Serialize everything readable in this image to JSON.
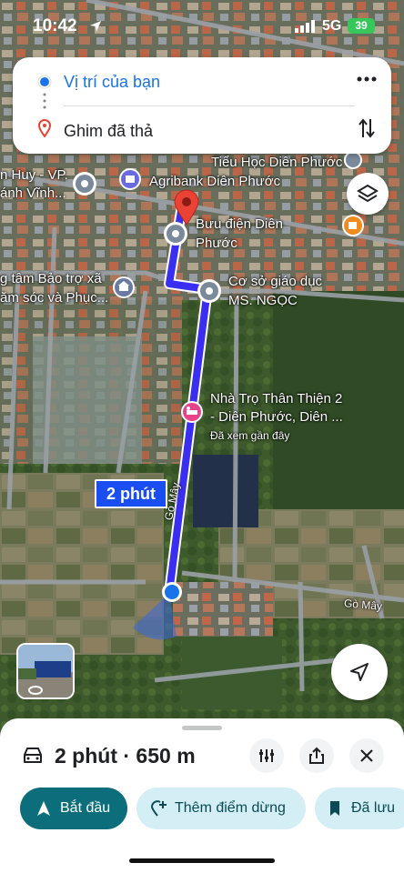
{
  "status_bar": {
    "time": "10:42",
    "network": "5G",
    "battery": "39"
  },
  "route": {
    "origin": "Vị trí của bạn",
    "destination": "Ghim đã thả",
    "origin_icon": "origin-dot-icon",
    "destination_icon": "location-pin-icon"
  },
  "map": {
    "duration_label": "2 phút",
    "labels": {
      "school_top": "Tiểu Học Diên Phước",
      "huy_1": "n Huy - VP.",
      "huy_2": "ánh Vĩnh...",
      "agribank": "Agribank Diên Phước",
      "post_1": "Bưu điện Diên",
      "post_2": "Phước",
      "center_1": "g tâm Bảo trợ xã",
      "center_2": "ăm sóc và Phục...",
      "edu_1": "Cơ sở giáo dục",
      "edu_2": "MS. NGỌC",
      "motel_1": "Nhà Trọ Thân Thiện 2",
      "motel_2": "- Diên Phước, Diên ...",
      "motel_3": "Đã xem gần đây",
      "road_vertical": "Gò Mây",
      "road_horizontal": "Gò Mây"
    }
  },
  "bottom_sheet": {
    "mode_icon": "car-icon",
    "summary": "2 phút · 650 m",
    "start_label": "Bắt đầu",
    "add_stop_label": "Thêm điểm dừng",
    "saved_label": "Đã lưu"
  },
  "colors": {
    "route": "#3a2ff0",
    "accent_blue": "#1a73e8",
    "start_button": "#0b6e7a",
    "secondary_button": "#d3eef4",
    "pin_red": "#ea4335"
  }
}
